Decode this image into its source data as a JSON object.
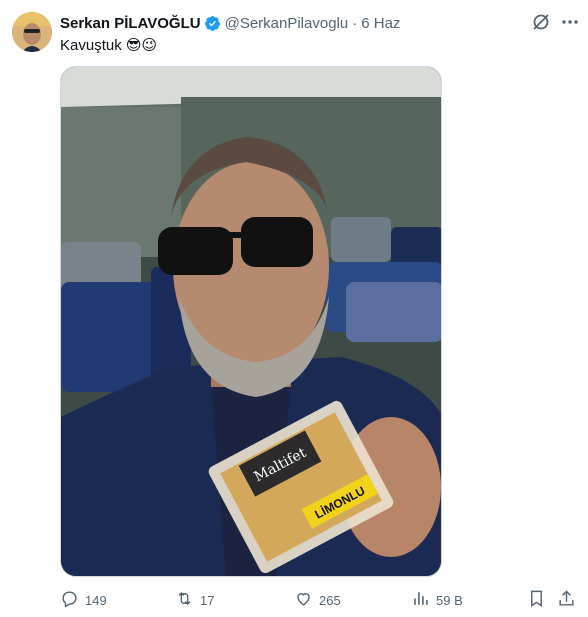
{
  "tweet": {
    "author_name": "Serkan PİLAVOĞLU",
    "handle": "@SerkanPilavoglu",
    "separator": "·",
    "time": "6 Haz",
    "text": "Kavuştuk 😎😉",
    "verified": true
  },
  "photo": {
    "package_brand": "Maltifet",
    "package_label": "LİMONLU"
  },
  "actions": {
    "replies": "149",
    "retweets": "17",
    "likes": "265",
    "views": "59 B"
  },
  "colors": {
    "verified_blue": "#1d9bf0",
    "secondary_text": "#536471",
    "primary_text": "#0f1419"
  },
  "icons": [
    "grok-icon",
    "more-icon",
    "reply-icon",
    "retweet-icon",
    "like-icon",
    "views-icon",
    "bookmark-icon",
    "share-icon"
  ]
}
